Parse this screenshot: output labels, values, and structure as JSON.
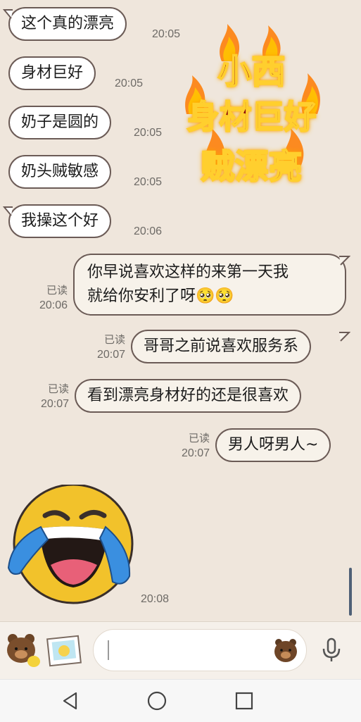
{
  "messages": [
    {
      "text": "这个真的漂亮",
      "time": "20:05"
    },
    {
      "text": "身材巨好",
      "time": "20:05"
    },
    {
      "text": "奶子是圆的",
      "time": "20:05"
    },
    {
      "text": "奶头贼敏感",
      "time": "20:05"
    },
    {
      "text": "我操这个好",
      "time": "20:06"
    },
    {
      "line1": "你早说喜欢这样的来第一天我",
      "line2": "就给你安利了呀🥺🥺",
      "read": "已读",
      "time": "20:06"
    },
    {
      "text": "哥哥之前说喜欢服务系",
      "read": "已读",
      "time": "20:07"
    },
    {
      "text": "看到漂亮身材好的还是很喜欢",
      "read": "已读",
      "time": "20:07"
    },
    {
      "text": "男人呀男人~",
      "read": "已读",
      "time": "20:07"
    },
    {
      "time": "20:08"
    }
  ],
  "sticker_text": {
    "line1": "小西",
    "line2": "身材巨好",
    "line3": "贼漂亮"
  },
  "icons": {
    "bear_sticker": "bear-sticker-icon",
    "photo": "photo-icon",
    "emoji_bear": "bear-emoji-icon",
    "mic": "microphone-icon",
    "back": "back-icon",
    "home": "home-icon",
    "recents": "recents-icon"
  },
  "colors": {
    "bubble_border": "#6b5b56",
    "chat_bg": "#efe6dc"
  }
}
